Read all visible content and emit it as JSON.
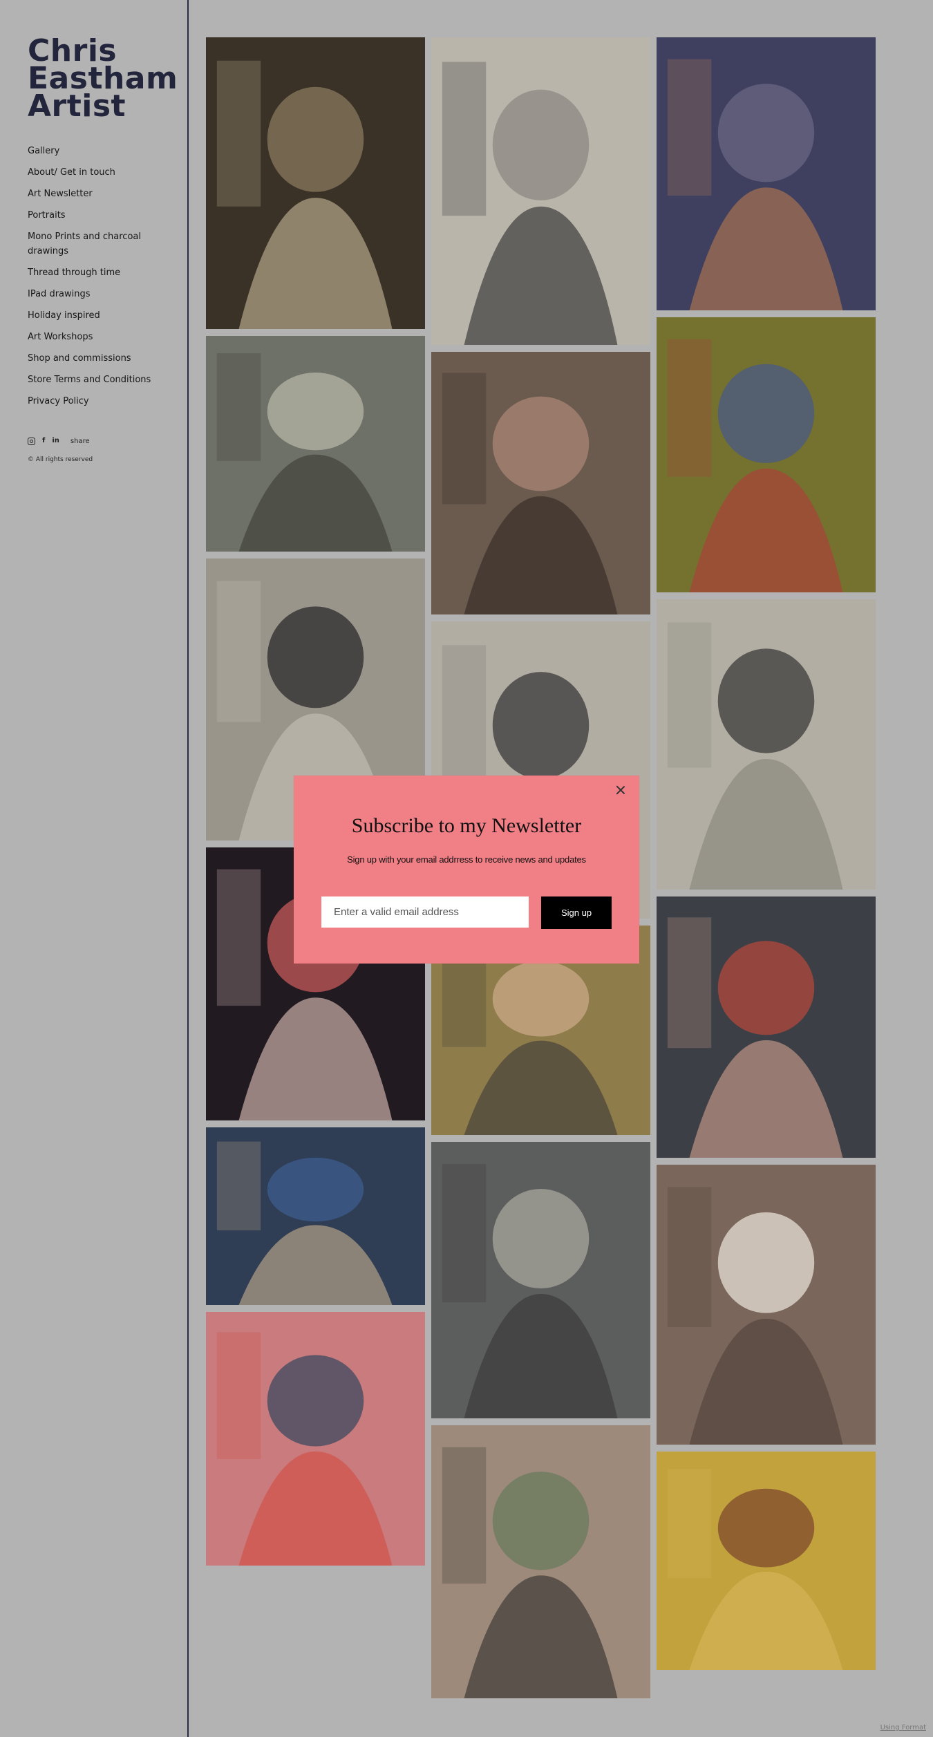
{
  "site": {
    "title": "Chris\nEastham\nArtist"
  },
  "nav": [
    "Gallery",
    "About/ Get in touch",
    "Art Newsletter",
    "Portraits",
    "Mono Prints and charcoal drawings",
    "Thread through time",
    "IPad drawings",
    "Holiday inspired",
    "Art Workshops",
    "Shop and commissions",
    "Store Terms and Conditions",
    "Privacy Policy"
  ],
  "social": {
    "instagram": "instagram-icon",
    "facebook": "f",
    "linkedin": "in",
    "share": "share"
  },
  "copyright": "© All rights reserved",
  "modal": {
    "title": "Subscribe to my Newsletter",
    "subtitle": "Sign up with your email addrress to receive news and updates",
    "email_placeholder": "Enter a valid email address",
    "button": "Sign up"
  },
  "footer": {
    "link": "Using Format"
  },
  "colors": {
    "background": "#b3b3b3",
    "title": "#23253d",
    "modal": "#f07f86",
    "button": "#000000"
  },
  "gallery": [
    {
      "name": "artwork-flappers-walking",
      "palette": [
        "#3a3226",
        "#8a7a5e",
        "#c9b99a"
      ]
    },
    {
      "name": "artwork-charcoal-couple",
      "palette": [
        "#b9b5ab",
        "#8d8a83",
        "#2a2a2a"
      ]
    },
    {
      "name": "artwork-woman-with-wine",
      "palette": [
        "#3f4060",
        "#6a6580",
        "#b77a4e"
      ]
    },
    {
      "name": "artwork-majestic-crowd",
      "palette": [
        "#6e7168",
        "#b7b6a6",
        "#3b3a33"
      ]
    },
    {
      "name": "artwork-city-street",
      "palette": [
        "#6b5a4e",
        "#a98676",
        "#2e2622"
      ]
    },
    {
      "name": "artwork-man-in-blue-suit",
      "palette": [
        "#75712f",
        "#4a5b86",
        "#b23b3a"
      ]
    },
    {
      "name": "artwork-monoprint-portrait",
      "palette": [
        "#9a958b",
        "#2b2b2b",
        "#c8c3b8"
      ]
    },
    {
      "name": "artwork-charcoal-man-hand",
      "palette": [
        "#b2ada3",
        "#3a3a3a",
        "#7a7770"
      ]
    },
    {
      "name": "artwork-woman-in-beanie",
      "palette": [
        "#b2aea3",
        "#3b3b3b",
        "#85827a"
      ]
    },
    {
      "name": "artwork-ballet-dancer",
      "palette": [
        "#211a20",
        "#c45a5a",
        "#e6c8c2"
      ]
    },
    {
      "name": "artwork-boy-portrait",
      "palette": [
        "#8e7c4a",
        "#c9a988",
        "#3c3a38"
      ]
    },
    {
      "name": "artwork-woman-red-hair",
      "palette": [
        "#3d3f46",
        "#b14a3c",
        "#d4a38f"
      ]
    },
    {
      "name": "artwork-woman-blue-coat",
      "palette": [
        "#2f3d55",
        "#3e5d8e",
        "#c9b28d"
      ]
    },
    {
      "name": "artwork-crowd-of-men",
      "palette": [
        "#5c5e5d",
        "#a7a69c",
        "#343534"
      ]
    },
    {
      "name": "artwork-chefs-group",
      "palette": [
        "#7a665a",
        "#e7e0d6",
        "#4f4038"
      ]
    },
    {
      "name": "artwork-pink-street",
      "palette": [
        "#c97b7e",
        "#3c4a60",
        "#d34b3f"
      ]
    },
    {
      "name": "artwork-two-women",
      "palette": [
        "#9d8a7a",
        "#6a7a5e",
        "#2f2f2c"
      ]
    },
    {
      "name": "artwork-autumn-park",
      "palette": [
        "#c2a23c",
        "#7f4a2e",
        "#d6b65a"
      ]
    }
  ]
}
